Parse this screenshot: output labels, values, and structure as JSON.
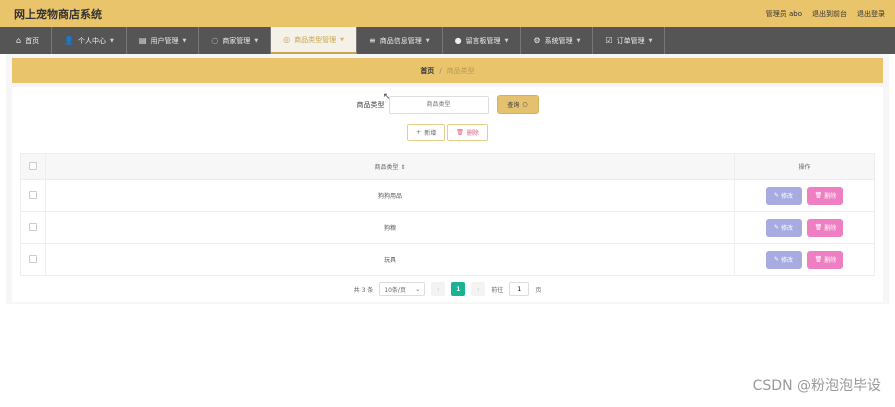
{
  "header": {
    "title": "网上宠物商店系统",
    "user": "管理员 abo",
    "front_link": "退出到前台",
    "logout": "退出登录"
  },
  "nav": [
    {
      "label": "首页",
      "icon": "home-icon",
      "glyph": "⌂"
    },
    {
      "label": "个人中心",
      "icon": "user-icon",
      "glyph": "👤"
    },
    {
      "label": "用户管理",
      "icon": "users-icon",
      "glyph": "▤"
    },
    {
      "label": "商家管理",
      "icon": "shop-icon",
      "glyph": "◌"
    },
    {
      "label": "商品类型管理",
      "icon": "category-icon",
      "glyph": "◎",
      "active": true
    },
    {
      "label": "商品信息管理",
      "icon": "list-icon",
      "glyph": "≡"
    },
    {
      "label": "留言板管理",
      "icon": "pin-icon",
      "glyph": "●"
    },
    {
      "label": "系统管理",
      "icon": "gear-icon",
      "glyph": "⚙"
    },
    {
      "label": "订单管理",
      "icon": "order-icon",
      "glyph": "☑"
    }
  ],
  "breadcrumb": {
    "home": "首页",
    "separator": "/",
    "current": "商品类型"
  },
  "search": {
    "label": "商品类型",
    "placeholder": "商品类型",
    "button": "查询"
  },
  "actions": {
    "add": "新增",
    "delete": "删除"
  },
  "table": {
    "headers": [
      "商品类型 ⇕",
      "操作"
    ],
    "rows": [
      {
        "name": "狗狗用品"
      },
      {
        "name": "狗粮"
      },
      {
        "name": "玩具"
      }
    ],
    "edit_label": "修改",
    "delete_label": "删除"
  },
  "pagination": {
    "total": "共 3 条",
    "page_size": "10条/页",
    "current_page": "1",
    "goto_label": "前往",
    "goto_value": "1",
    "page_suffix": "页"
  },
  "watermark": "CSDN @粉泡泡毕设",
  "colors": {
    "header": "#e9c46a",
    "nav": "#555555",
    "edit": "#a7abdf",
    "delete": "#ef7fc3",
    "pager_active": "#19b394"
  }
}
